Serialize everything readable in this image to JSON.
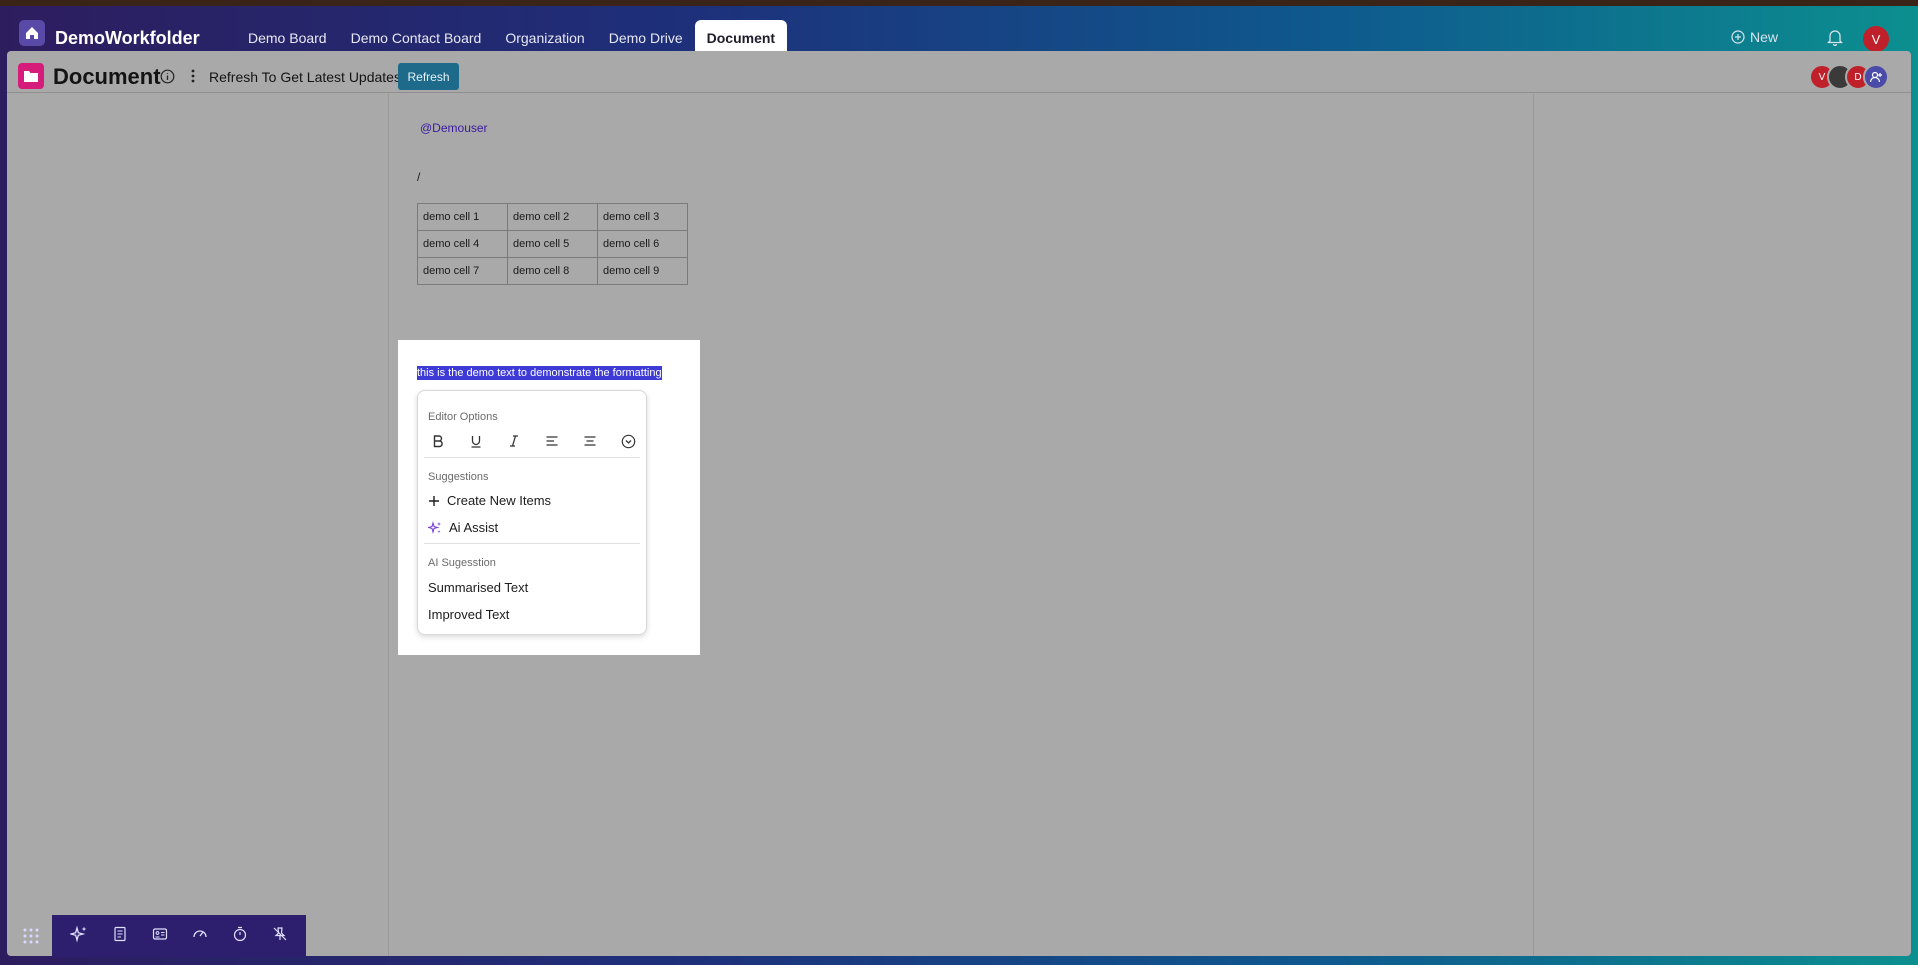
{
  "app": {
    "title": "DemoWorkfolder"
  },
  "tabs": [
    {
      "label": "Demo Board"
    },
    {
      "label": "Demo Contact Board"
    },
    {
      "label": "Organization"
    },
    {
      "label": "Demo Drive"
    },
    {
      "label": "Document",
      "active": true
    }
  ],
  "header_actions": {
    "new_label": "New",
    "user_initial": "V"
  },
  "document": {
    "title": "Document",
    "refresh_message": "Refresh To Get Latest Updates",
    "refresh_button": "Refresh",
    "collaborators": [
      {
        "initial": "V",
        "color": "#c0202a"
      },
      {
        "initial": "",
        "color": "#3a3a3a"
      },
      {
        "initial": "D",
        "color": "#c0202a"
      },
      {
        "initial": "",
        "color": "#4a4aa8"
      }
    ]
  },
  "content": {
    "mention": "@Demouser",
    "slash": "/",
    "table": [
      [
        "demo cell 1",
        "demo cell 2",
        "demo cell 3"
      ],
      [
        "demo cell 4",
        "demo cell 5",
        "demo cell 6"
      ],
      [
        "demo cell 7",
        "demo cell 8",
        "demo cell 9"
      ]
    ],
    "selected_text": "this is the demo text to demonstrate the formatting"
  },
  "editor_menu": {
    "options_heading": "Editor Options",
    "suggestions_heading": "Suggestions",
    "create_new": "Create New Items",
    "ai_assist": "Ai Assist",
    "ai_suggestion_heading": "AI Sugesstion",
    "summarised": "Summarised Text",
    "improved": "Improved Text"
  },
  "colors": {
    "accent": "#3d3ad6",
    "doc_icon": "#d51c7b",
    "refresh_button": "#1e6a8a",
    "ai_icon": "#7b3fd6"
  }
}
